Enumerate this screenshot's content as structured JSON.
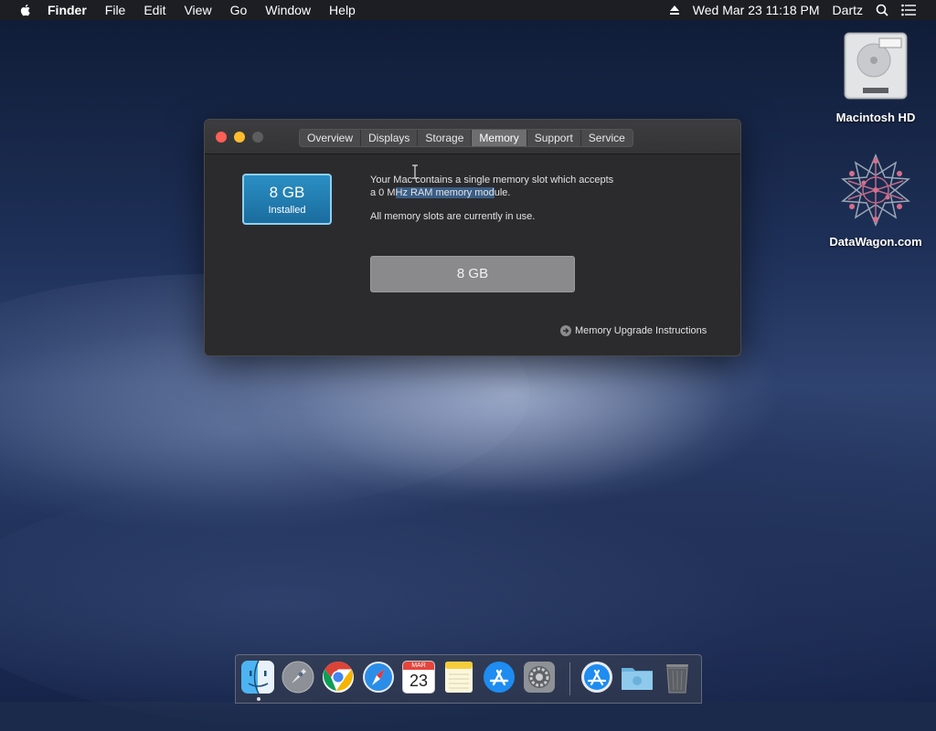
{
  "menubar": {
    "app_name": "Finder",
    "items": [
      "File",
      "Edit",
      "View",
      "Go",
      "Window",
      "Help"
    ],
    "status": {
      "datetime": "Wed Mar 23  11:18 PM",
      "user": "Dartz"
    },
    "icons": [
      "apple-icon",
      "eject-icon",
      "spotlight-search-icon",
      "notification-center-icon"
    ]
  },
  "desktop": {
    "icons": [
      {
        "label": "Macintosh HD",
        "icon": "hard-drive-icon"
      },
      {
        "label": "DataWagon.com",
        "icon": "datawagon-logo-icon"
      }
    ]
  },
  "window": {
    "tabs": [
      "Overview",
      "Displays",
      "Storage",
      "Memory",
      "Support",
      "Service"
    ],
    "active_tab": "Memory",
    "installed": {
      "size": "8 GB",
      "label": "Installed"
    },
    "description": {
      "line1": "Your Mac contains a single memory slot which accepts",
      "line2_pre": "a 0 M",
      "line2_sel": "Hz RAM memory mod",
      "line2_post": "ule.",
      "line3": "All memory slots are currently in use."
    },
    "slot": {
      "size": "8 GB"
    },
    "upgrade_link": "Memory Upgrade Instructions"
  },
  "dock": {
    "calendar": {
      "month": "MAR",
      "day": "23"
    },
    "apps": [
      "finder-icon",
      "launchpad-icon",
      "chrome-icon",
      "safari-icon",
      "calendar-icon",
      "notes-icon",
      "app-store-icon",
      "system-preferences-icon",
      "app-store-download-icon",
      "downloads-folder-icon",
      "trash-icon"
    ]
  },
  "colors": {
    "accent_blue": "#2a8fc4",
    "close": "#ff5f57",
    "minimize": "#febc2e"
  }
}
